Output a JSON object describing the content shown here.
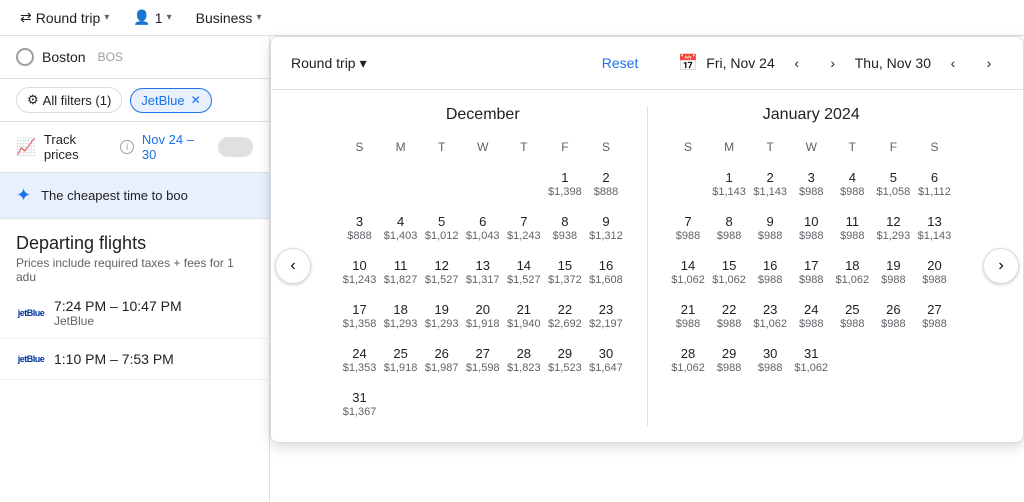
{
  "topbar": {
    "trip_type": "Round trip",
    "passengers": "1",
    "class": "Business",
    "chevron": "▾"
  },
  "left_panel": {
    "search": {
      "city": "Boston",
      "code": "BOS"
    },
    "filters": {
      "all_filters": "All filters (1)",
      "jetblue": "JetBlue",
      "close": "✕"
    },
    "track": {
      "label": "Track prices",
      "date_range": "Nov 24 – 30"
    },
    "cheapest": {
      "text": "The cheapest time to boo"
    },
    "departing": {
      "title": "Departing flights",
      "sub": "Prices include required taxes + fees for 1 adu"
    },
    "flights": [
      {
        "airline": "jetBlue",
        "times": "7:24 PM – 10:47 PM",
        "airline_name": "JetBlue"
      },
      {
        "airline": "jetBlue",
        "times": "1:10 PM – 7:53 PM",
        "airline_name": ""
      }
    ]
  },
  "calendar": {
    "round_trip_label": "Round trip",
    "reset_label": "Reset",
    "date_from": "Fri, Nov 24",
    "date_to": "Thu, Nov 30",
    "nav_prev": "‹",
    "nav_next": "›",
    "december": {
      "title": "December",
      "days_header": [
        "S",
        "M",
        "T",
        "W",
        "T",
        "F",
        "S"
      ],
      "weeks": [
        [
          {
            "day": "",
            "price": ""
          },
          {
            "day": "",
            "price": ""
          },
          {
            "day": "",
            "price": ""
          },
          {
            "day": "",
            "price": ""
          },
          {
            "day": "",
            "price": ""
          },
          {
            "day": "1",
            "price": "$1,398"
          },
          {
            "day": "2",
            "price": "$888"
          }
        ],
        [
          {
            "day": "3",
            "price": "$888"
          },
          {
            "day": "4",
            "price": "$1,403"
          },
          {
            "day": "5",
            "price": "$1,012"
          },
          {
            "day": "6",
            "price": "$1,043"
          },
          {
            "day": "7",
            "price": "$1,243"
          },
          {
            "day": "8",
            "price": "$938"
          },
          {
            "day": "9",
            "price": "$1,312"
          }
        ],
        [
          {
            "day": "10",
            "price": "$1,243"
          },
          {
            "day": "11",
            "price": "$1,827"
          },
          {
            "day": "12",
            "price": "$1,527"
          },
          {
            "day": "13",
            "price": "$1,317"
          },
          {
            "day": "14",
            "price": "$1,527"
          },
          {
            "day": "15",
            "price": "$1,372"
          },
          {
            "day": "16",
            "price": "$1,608"
          }
        ],
        [
          {
            "day": "17",
            "price": "$1,358"
          },
          {
            "day": "18",
            "price": "$1,293"
          },
          {
            "day": "19",
            "price": "$1,293"
          },
          {
            "day": "20",
            "price": "$1,918"
          },
          {
            "day": "21",
            "price": "$1,940"
          },
          {
            "day": "22",
            "price": "$2,692"
          },
          {
            "day": "23",
            "price": "$2,197"
          }
        ],
        [
          {
            "day": "24",
            "price": "$1,353"
          },
          {
            "day": "25",
            "price": "$1,918"
          },
          {
            "day": "26",
            "price": "$1,987"
          },
          {
            "day": "27",
            "price": "$1,598"
          },
          {
            "day": "28",
            "price": "$1,823"
          },
          {
            "day": "29",
            "price": "$1,523"
          },
          {
            "day": "30",
            "price": "$1,647"
          }
        ],
        [
          {
            "day": "31",
            "price": "$1,367"
          },
          {
            "day": "",
            "price": ""
          },
          {
            "day": "",
            "price": ""
          },
          {
            "day": "",
            "price": ""
          },
          {
            "day": "",
            "price": ""
          },
          {
            "day": "",
            "price": ""
          },
          {
            "day": "",
            "price": ""
          }
        ]
      ]
    },
    "january": {
      "title": "January 2024",
      "days_header": [
        "S",
        "M",
        "T",
        "W",
        "T",
        "F",
        "S"
      ],
      "weeks": [
        [
          {
            "day": "",
            "price": ""
          },
          {
            "day": "1",
            "price": "$1,143"
          },
          {
            "day": "2",
            "price": "$1,143"
          },
          {
            "day": "3",
            "price": "$988"
          },
          {
            "day": "4",
            "price": "$988"
          },
          {
            "day": "5",
            "price": "$1,058"
          },
          {
            "day": "6",
            "price": "$1,112"
          }
        ],
        [
          {
            "day": "7",
            "price": "$988"
          },
          {
            "day": "8",
            "price": "$988"
          },
          {
            "day": "9",
            "price": "$988"
          },
          {
            "day": "10",
            "price": "$988"
          },
          {
            "day": "11",
            "price": "$988"
          },
          {
            "day": "12",
            "price": "$1,293"
          },
          {
            "day": "13",
            "price": "$1,143"
          }
        ],
        [
          {
            "day": "14",
            "price": "$1,062"
          },
          {
            "day": "15",
            "price": "$1,062"
          },
          {
            "day": "16",
            "price": "$988"
          },
          {
            "day": "17",
            "price": "$988"
          },
          {
            "day": "18",
            "price": "$1,062"
          },
          {
            "day": "19",
            "price": "$988"
          },
          {
            "day": "20",
            "price": "$988"
          }
        ],
        [
          {
            "day": "21",
            "price": "$988"
          },
          {
            "day": "22",
            "price": "$988"
          },
          {
            "day": "23",
            "price": "$1,062"
          },
          {
            "day": "24",
            "price": "$988"
          },
          {
            "day": "25",
            "price": "$988"
          },
          {
            "day": "26",
            "price": "$988"
          },
          {
            "day": "27",
            "price": "$988"
          }
        ],
        [
          {
            "day": "28",
            "price": "$1,062"
          },
          {
            "day": "29",
            "price": "$988"
          },
          {
            "day": "30",
            "price": "$988"
          },
          {
            "day": "31",
            "price": "$1,062"
          },
          {
            "day": "",
            "price": ""
          },
          {
            "day": "",
            "price": ""
          },
          {
            "day": "",
            "price": ""
          }
        ]
      ]
    }
  }
}
